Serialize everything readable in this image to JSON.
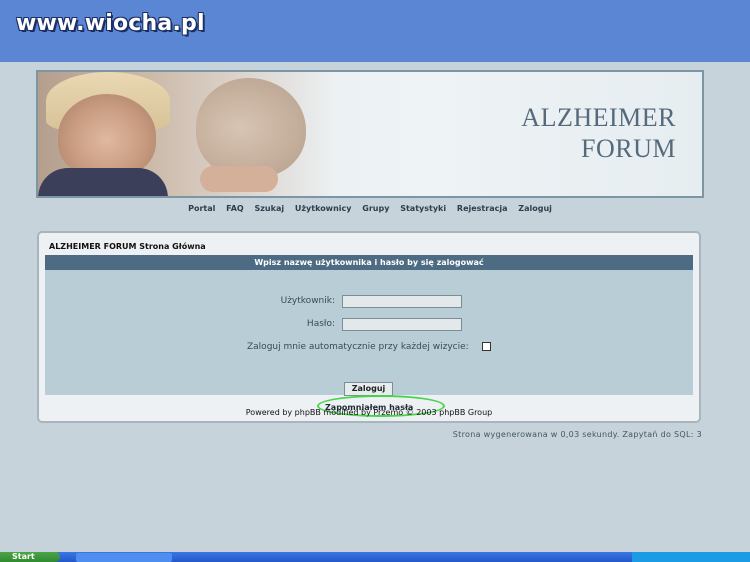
{
  "watermark": "www.wiocha.pl",
  "banner": {
    "title_line1": "ALZHEIMER",
    "title_line2": "FORUM"
  },
  "nav": [
    "Portal",
    "FAQ",
    "Szukaj",
    "Użytkownicy",
    "Grupy",
    "Statystyki",
    "Rejestracja",
    "Zaloguj"
  ],
  "breadcrumb": "ALZHEIMER FORUM Strona Główna",
  "login": {
    "header": "Wpisz nazwę użytkownika i hasło by się zalogować",
    "username_label": "Użytkownik:",
    "password_label": "Hasło:",
    "username_value": "",
    "password_value": "",
    "autologin_label": "Zaloguj mnie automatycznie przy każdej wizycie:",
    "autologin_checked": false,
    "submit_label": "Zaloguj",
    "forgot_label": "Zapomniałem hasła"
  },
  "footer": "Powered by phpBB modified by Przemo © 2003 phpBB Group",
  "stats": "Strona wygenerowana w 0,03 sekundy. Zapytań do SQL: 3",
  "taskbar": {
    "start_label": "Start"
  },
  "colors": {
    "watermark_bar": "#5a86d4",
    "login_header": "#4d6b82",
    "login_body": "#b8cdd6",
    "highlight_circle": "#46d44a"
  }
}
